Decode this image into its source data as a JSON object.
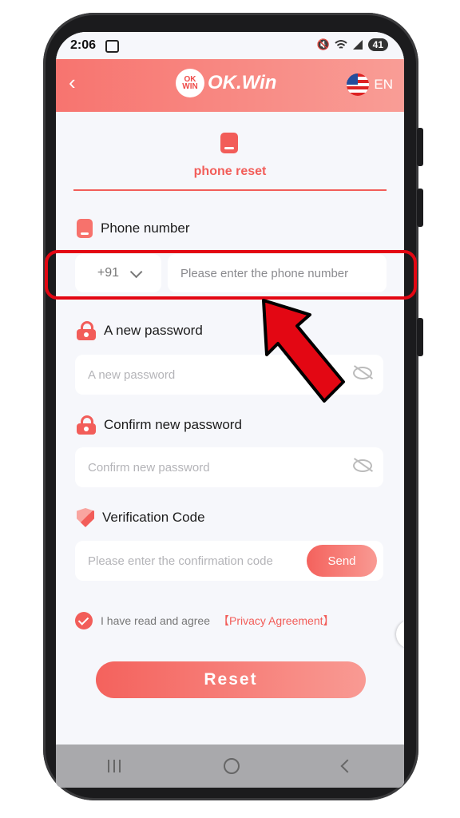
{
  "status_bar": {
    "time": "2:06",
    "battery": "41",
    "icons": [
      "screenshot-icon",
      "mute-icon",
      "wifi-icon",
      "signal-icon",
      "battery-icon"
    ]
  },
  "header": {
    "logo_badge": "OK WIN",
    "logo_text": "OK.Win",
    "language": "EN"
  },
  "tab": {
    "label": "phone reset"
  },
  "phone_section": {
    "label": "Phone number",
    "country_code": "+91",
    "placeholder": "Please enter the phone number"
  },
  "password_section": {
    "label": "A new password",
    "placeholder": "A new password"
  },
  "confirm_section": {
    "label": "Confirm new password",
    "placeholder": "Confirm new password"
  },
  "verification_section": {
    "label": "Verification Code",
    "placeholder": "Please enter the confirmation code",
    "send_label": "Send"
  },
  "agreement": {
    "text": "I have read and agree",
    "link": "【Privacy Agreement】",
    "checked": true
  },
  "reset_button": {
    "label": "Reset"
  },
  "colors": {
    "accent": "#f25d59",
    "annotation": "#e30713"
  }
}
